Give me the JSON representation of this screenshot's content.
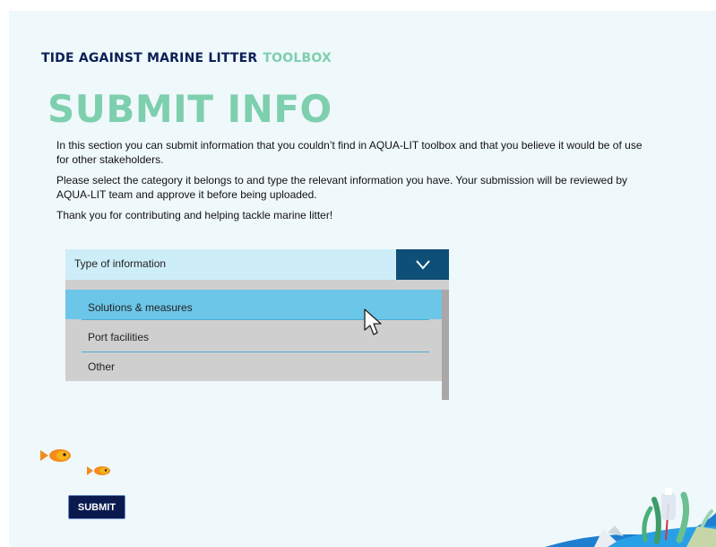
{
  "brand": {
    "part1": "TIDE AGAINST MARINE LITTER",
    "part2": "TOOLBOX"
  },
  "title": "SUBMIT INFO",
  "intro": {
    "p1": "In this section you can submit information that you couldn’t find in AQUA-LIT toolbox and that you believe it would be of use for other stakeholders.",
    "p2": "Please select the category it belongs to and type the relevant information you have. Your submission will be reviewed by AQUA-LIT team and approve it before being uploaded.",
    "p3": "Thank you for contributing and helping tackle marine litter!"
  },
  "dropdown": {
    "placeholder": "Type of information",
    "options": [
      "Solutions & measures",
      "Port facilities",
      "Other"
    ],
    "highlighted": "Solutions & measures"
  },
  "submit_label": "SUBMIT",
  "icons": [
    "chevron-down-icon",
    "mouse-pointer-icon",
    "fish-icon",
    "seaweed-decoration"
  ],
  "colors": {
    "brand_navy": "#0b1f56",
    "brand_green": "#7dcfae",
    "dropdown_toggle": "#0d4f77",
    "highlight": "#6cc6e8"
  }
}
